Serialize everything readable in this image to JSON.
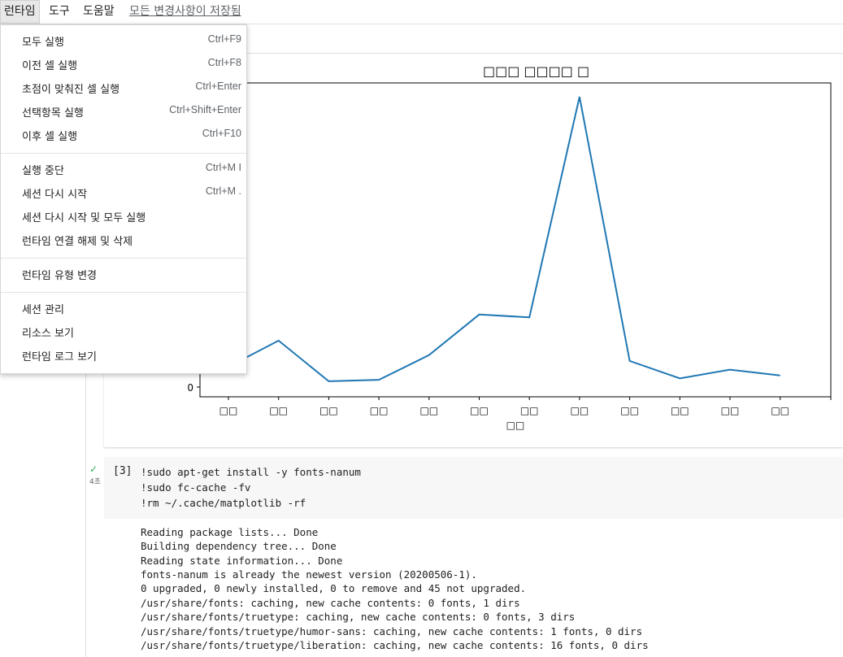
{
  "menubar": {
    "runtime": "런타임",
    "tools": "도구",
    "help": "도움말",
    "saved_status": "모든 변경사항이 저장됨"
  },
  "runtime_menu": {
    "items": [
      {
        "label": "모두 실행",
        "shortcut": "Ctrl+F9"
      },
      {
        "label": "이전 셀 실행",
        "shortcut": "Ctrl+F8"
      },
      {
        "label": "초점이 맞춰진 셀 실행",
        "shortcut": "Ctrl+Enter"
      },
      {
        "label": "선택항목 실행",
        "shortcut": "Ctrl+Shift+Enter"
      },
      {
        "label": "이후 셀 실행",
        "shortcut": "Ctrl+F10"
      },
      {
        "label": "실행 중단",
        "shortcut": "Ctrl+M I"
      },
      {
        "label": "세션 다시 시작",
        "shortcut": "Ctrl+M ."
      },
      {
        "label": "세션 다시 시작 및 모두 실행",
        "shortcut": ""
      },
      {
        "label": "런타임 연결 해제 및 삭제",
        "shortcut": ""
      },
      {
        "label": "런타임 유형 변경",
        "shortcut": ""
      },
      {
        "label": "세션 관리",
        "shortcut": ""
      },
      {
        "label": "리소스 보기",
        "shortcut": ""
      },
      {
        "label": "런타임 로그 보기",
        "shortcut": ""
      }
    ]
  },
  "plot": {
    "title": "□□□ □□□□ □",
    "xlabel": "□□",
    "y_tick": "0",
    "colors": {
      "line": "#1f77b4"
    }
  },
  "chart_data": {
    "type": "line",
    "title": "□□□ □□□□ □",
    "xlabel": "□□",
    "ylabel": "",
    "categories": [
      "□□",
      "□□",
      "□□",
      "□□",
      "□□",
      "□□",
      "□□",
      "□□",
      "□□",
      "□□",
      "□□",
      "□□"
    ],
    "series": [
      {
        "values": [
          0.7,
          1.6,
          0.2,
          0.25,
          1.1,
          2.5,
          2.4,
          10.0,
          0.9,
          0.3,
          0.6,
          0.4
        ]
      }
    ],
    "ylim_visible_tick": 0,
    "grid": false
  },
  "cell": {
    "exec_count": "[3]",
    "run_time": "4초",
    "code": [
      "!sudo apt-get install -y fonts-nanum",
      "!sudo fc-cache -fv",
      "!rm ~/.cache/matplotlib -rf"
    ],
    "output": [
      "Reading package lists... Done",
      "Building dependency tree... Done",
      "Reading state information... Done",
      "fonts-nanum is already the newest version (20200506-1).",
      "0 upgraded, 0 newly installed, 0 to remove and 45 not upgraded.",
      "/usr/share/fonts: caching, new cache contents: 0 fonts, 1 dirs",
      "/usr/share/fonts/truetype: caching, new cache contents: 0 fonts, 3 dirs",
      "/usr/share/fonts/truetype/humor-sans: caching, new cache contents: 1 fonts, 0 dirs",
      "/usr/share/fonts/truetype/liberation: caching, new cache contents: 16 fonts, 0 dirs"
    ]
  }
}
